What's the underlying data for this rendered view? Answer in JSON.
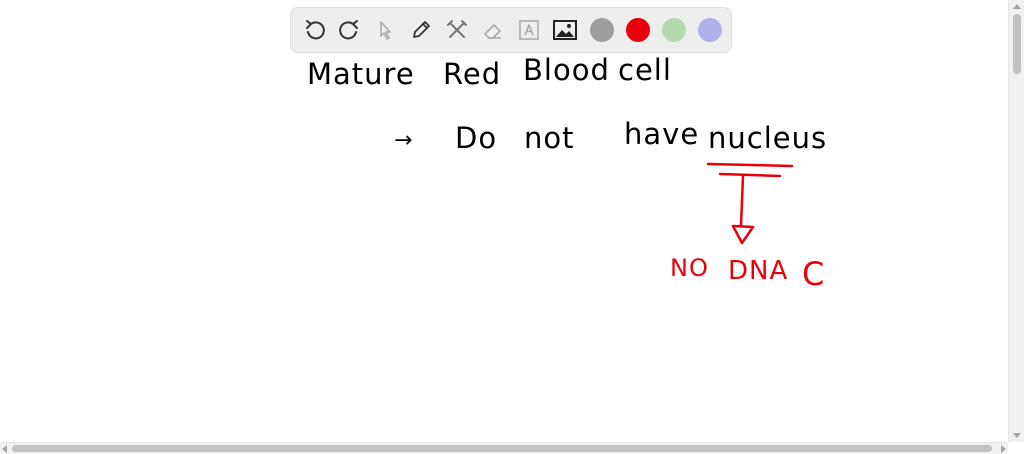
{
  "toolbar": {
    "tools": [
      {
        "name": "undo-icon"
      },
      {
        "name": "redo-icon"
      },
      {
        "name": "select-pointer-icon"
      },
      {
        "name": "pen-icon"
      },
      {
        "name": "tools-icon"
      },
      {
        "name": "eraser-icon"
      },
      {
        "name": "text-tool-icon"
      },
      {
        "name": "image-icon"
      }
    ],
    "colors": [
      "#9e9e9e",
      "#e8000b",
      "#b5d9ae",
      "#b0b0ea"
    ]
  },
  "whiteboard": {
    "line1": {
      "words": [
        "Mature",
        "Red",
        "Blood",
        "cell"
      ],
      "color": "#000000"
    },
    "line2": {
      "bullet": "→",
      "words": [
        "Do",
        "not",
        "have",
        "nucleus"
      ],
      "color": "#000000"
    },
    "annotation": {
      "no": "NO",
      "dna": "DNA",
      "c": "C",
      "color": "#e8000b"
    }
  }
}
